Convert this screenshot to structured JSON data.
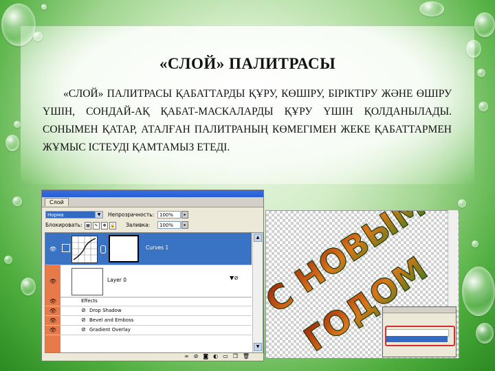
{
  "slide": {
    "title": "«СЛОЙ» ПАЛИТРАСЫ",
    "body": "«Слой» палитрасы қабаттарды құру, көшіру, біріктіру және өшіру үшін, сондай-ақ қабат-маскаларды құру үшін қолданылады. Сонымен қатар, аталған палитраның көмегімен жеке қабаттармен жұмыс істеуді қамтамыз етеді."
  },
  "layers_palette": {
    "tab": "Слой",
    "blend_mode": "Норма",
    "opacity_label": "Непрозрачность:",
    "opacity_value": "100%",
    "lock_label": "Блокировать:",
    "fill_label": "Заливка:",
    "fill_value": "100%",
    "layers": [
      {
        "name": "Curves 1"
      },
      {
        "name": "Layer 0"
      }
    ],
    "effects_label": "Effects",
    "effects": [
      "Drop Shadow",
      "Bevel and Emboss",
      "Gradient Overlay"
    ]
  },
  "artwork": {
    "lines": [
      "С НОВЫМ",
      "ГОДОМ"
    ]
  },
  "colors": {
    "green_dark": "#2b8a22",
    "selection_blue": "#3b73c4",
    "visibility_orange": "#e87a4a",
    "highlight_red": "#d62b2b"
  }
}
